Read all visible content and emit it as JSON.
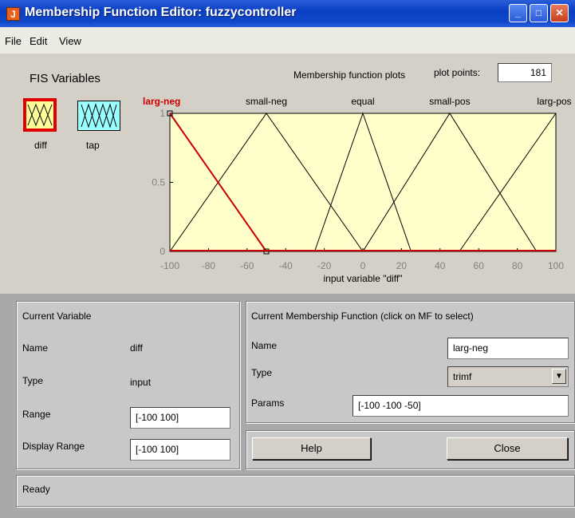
{
  "window": {
    "title": "Membership Function Editor: fuzzycontroller",
    "icon": "matlab-icon"
  },
  "menu": [
    "File",
    "Edit",
    "View"
  ],
  "fis_variables": {
    "heading": "FIS Variables",
    "items": [
      {
        "label": "diff",
        "selected": true
      },
      {
        "label": "tap",
        "selected": false
      }
    ]
  },
  "plot": {
    "title": "Membership function plots",
    "plot_points_label": "plot points:",
    "plot_points_value": "181",
    "xlabel": "input variable \"diff\""
  },
  "chart_data": {
    "type": "line",
    "xlim": [
      -100,
      100
    ],
    "ylim": [
      0,
      1
    ],
    "x_ticks": [
      "-100",
      "-80",
      "-60",
      "-40",
      "-20",
      "0",
      "20",
      "40",
      "60",
      "80",
      "100"
    ],
    "y_ticks": [
      "0",
      "0.5",
      "1"
    ],
    "xlabel": "input variable \"diff\"",
    "series": [
      {
        "name": "larg-neg",
        "points": [
          [
            -100,
            1
          ],
          [
            -100,
            1
          ],
          [
            -50,
            0
          ]
        ],
        "selected": true,
        "label_x": -100
      },
      {
        "name": "small-neg",
        "points": [
          [
            -100,
            0
          ],
          [
            -50,
            1
          ],
          [
            0,
            0
          ]
        ],
        "selected": false,
        "label_x": -50
      },
      {
        "name": "equal",
        "points": [
          [
            -25,
            0
          ],
          [
            0,
            1
          ],
          [
            25,
            0
          ]
        ],
        "selected": false,
        "label_x": 0
      },
      {
        "name": "small-pos",
        "points": [
          [
            0,
            0
          ],
          [
            45,
            1
          ],
          [
            90,
            0
          ]
        ],
        "selected": false,
        "label_x": 45
      },
      {
        "name": "larg-pos",
        "points": [
          [
            50,
            0
          ],
          [
            100,
            1
          ],
          [
            100,
            1
          ]
        ],
        "selected": false,
        "label_x": 100
      }
    ]
  },
  "current_variable": {
    "heading": "Current Variable",
    "name_label": "Name",
    "name_value": "diff",
    "type_label": "Type",
    "type_value": "input",
    "range_label": "Range",
    "range_value": "[-100 100]",
    "display_range_label": "Display Range",
    "display_range_value": "[-100 100]"
  },
  "current_mf": {
    "heading": "Current Membership Function (click on MF to select)",
    "name_label": "Name",
    "name_value": "larg-neg",
    "type_label": "Type",
    "type_value": "trimf",
    "params_label": "Params",
    "params_value": "[-100 -100 -50]"
  },
  "buttons": {
    "help": "Help",
    "close": "Close"
  },
  "status": "Ready",
  "colors": {
    "plot_bg": "#ffffcc",
    "selected_mf": "#cc0000",
    "icon_bg": "#ffff99",
    "icon_bg_2": "#99ffff"
  }
}
